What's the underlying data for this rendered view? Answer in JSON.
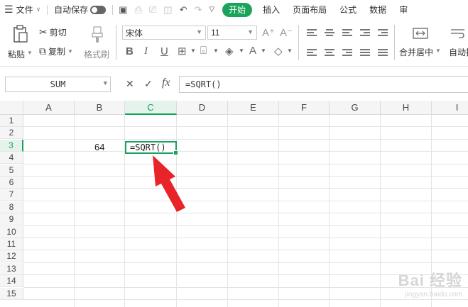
{
  "menubar": {
    "file_label": "文件",
    "autosave_label": "自动保存",
    "tabs": [
      "开始",
      "插入",
      "页面布局",
      "公式",
      "数据",
      "审"
    ]
  },
  "ribbon": {
    "paste_label": "粘贴",
    "cut_label": "剪切",
    "copy_label": "复制",
    "format_painter_label": "格式刷",
    "font_name": "宋体",
    "font_size": "11",
    "merge_label": "合并居中",
    "autowrap_label": "自动换"
  },
  "formula_bar": {
    "name_box": "SUM",
    "formula": "=SQRT()",
    "cancel_icon": "✕",
    "confirm_icon": "✓",
    "fx_label": "fx"
  },
  "sheet": {
    "columns": [
      "A",
      "B",
      "C",
      "D",
      "E",
      "F",
      "G",
      "H",
      "I"
    ],
    "rows": [
      "1",
      "2",
      "3",
      "4",
      "5",
      "6",
      "7",
      "8",
      "9",
      "10",
      "11",
      "12",
      "13",
      "14",
      "15"
    ],
    "selected_column": "C",
    "selected_row": "3",
    "cell_b3": "64",
    "cell_c3": "=SQRT()"
  },
  "watermark": {
    "brand": "Bai 经验",
    "url": "jingyan.baidu.com"
  },
  "colors": {
    "accent": "#1aa35b",
    "arrow": "#e8242a"
  }
}
